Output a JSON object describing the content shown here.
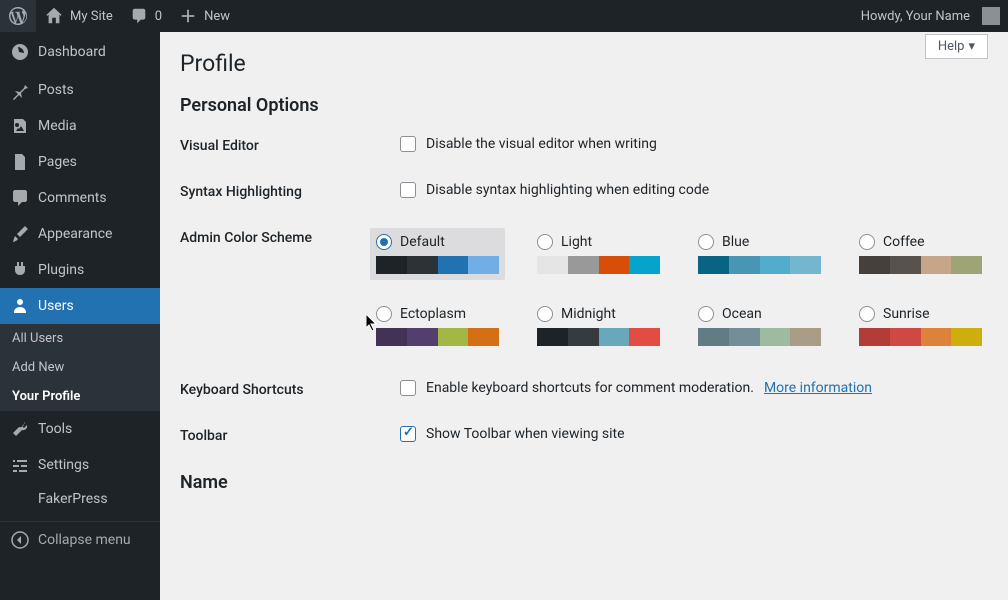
{
  "adminbar": {
    "site_name": "My Site",
    "comment_count": "0",
    "new_label": "New",
    "howdy": "Howdy, Your Name"
  },
  "sidebar": {
    "items": [
      {
        "label": "Dashboard"
      },
      {
        "label": "Posts"
      },
      {
        "label": "Media"
      },
      {
        "label": "Pages"
      },
      {
        "label": "Comments"
      },
      {
        "label": "Appearance"
      },
      {
        "label": "Plugins"
      },
      {
        "label": "Users"
      },
      {
        "label": "Tools"
      },
      {
        "label": "Settings"
      },
      {
        "label": "FakerPress"
      }
    ],
    "submenu": [
      {
        "label": "All Users"
      },
      {
        "label": "Add New"
      },
      {
        "label": "Your Profile"
      }
    ],
    "collapse": "Collapse menu"
  },
  "content": {
    "help": "Help",
    "title": "Profile",
    "section1": "Personal Options",
    "visual_editor": {
      "label": "Visual Editor",
      "text": "Disable the visual editor when writing"
    },
    "syntax": {
      "label": "Syntax Highlighting",
      "text": "Disable syntax highlighting when editing code"
    },
    "color_scheme": {
      "label": "Admin Color Scheme",
      "schemes": [
        {
          "name": "Default",
          "colors": [
            "#1d2327",
            "#2c3338",
            "#2271b1",
            "#72aee6"
          ],
          "selected": true
        },
        {
          "name": "Light",
          "colors": [
            "#e5e5e5",
            "#999999",
            "#d64e07",
            "#04a4cc"
          ]
        },
        {
          "name": "Blue",
          "colors": [
            "#096484",
            "#4796b3",
            "#52accc",
            "#74b6ce"
          ]
        },
        {
          "name": "Coffee",
          "colors": [
            "#46403c",
            "#59524c",
            "#c7a589",
            "#9ea476"
          ]
        },
        {
          "name": "Ectoplasm",
          "colors": [
            "#413256",
            "#523f6d",
            "#a3b745",
            "#d46f15"
          ]
        },
        {
          "name": "Midnight",
          "colors": [
            "#1d2327",
            "#363b3f",
            "#69a8bb",
            "#e14d43"
          ]
        },
        {
          "name": "Ocean",
          "colors": [
            "#627c83",
            "#738e96",
            "#9ebaa0",
            "#aa9d88"
          ]
        },
        {
          "name": "Sunrise",
          "colors": [
            "#b43c38",
            "#cf4944",
            "#dd823b",
            "#ccaf0b"
          ]
        }
      ]
    },
    "shortcuts": {
      "label": "Keyboard Shortcuts",
      "text": "Enable keyboard shortcuts for comment moderation.",
      "link": "More information"
    },
    "toolbar": {
      "label": "Toolbar",
      "text": "Show Toolbar when viewing site"
    },
    "section2": "Name"
  }
}
